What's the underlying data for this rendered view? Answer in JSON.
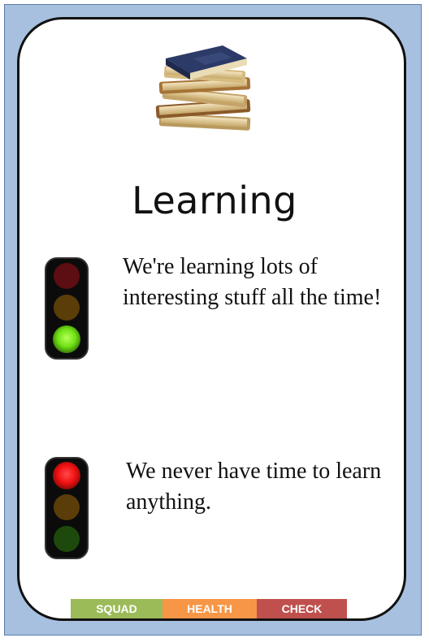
{
  "card": {
    "title": "Learning",
    "good": {
      "text": "We're learning lots of interesting stuff all the time!",
      "signal": "green"
    },
    "bad": {
      "text": "We never have time to learn anything.",
      "signal": "red"
    }
  },
  "footer": {
    "squad": "SQUAD",
    "health": "HEALTH",
    "check": "CHECK"
  },
  "colors": {
    "frame": "#a7c0df",
    "squad": "#9bbb59",
    "health": "#f79646",
    "check": "#c0504d"
  }
}
